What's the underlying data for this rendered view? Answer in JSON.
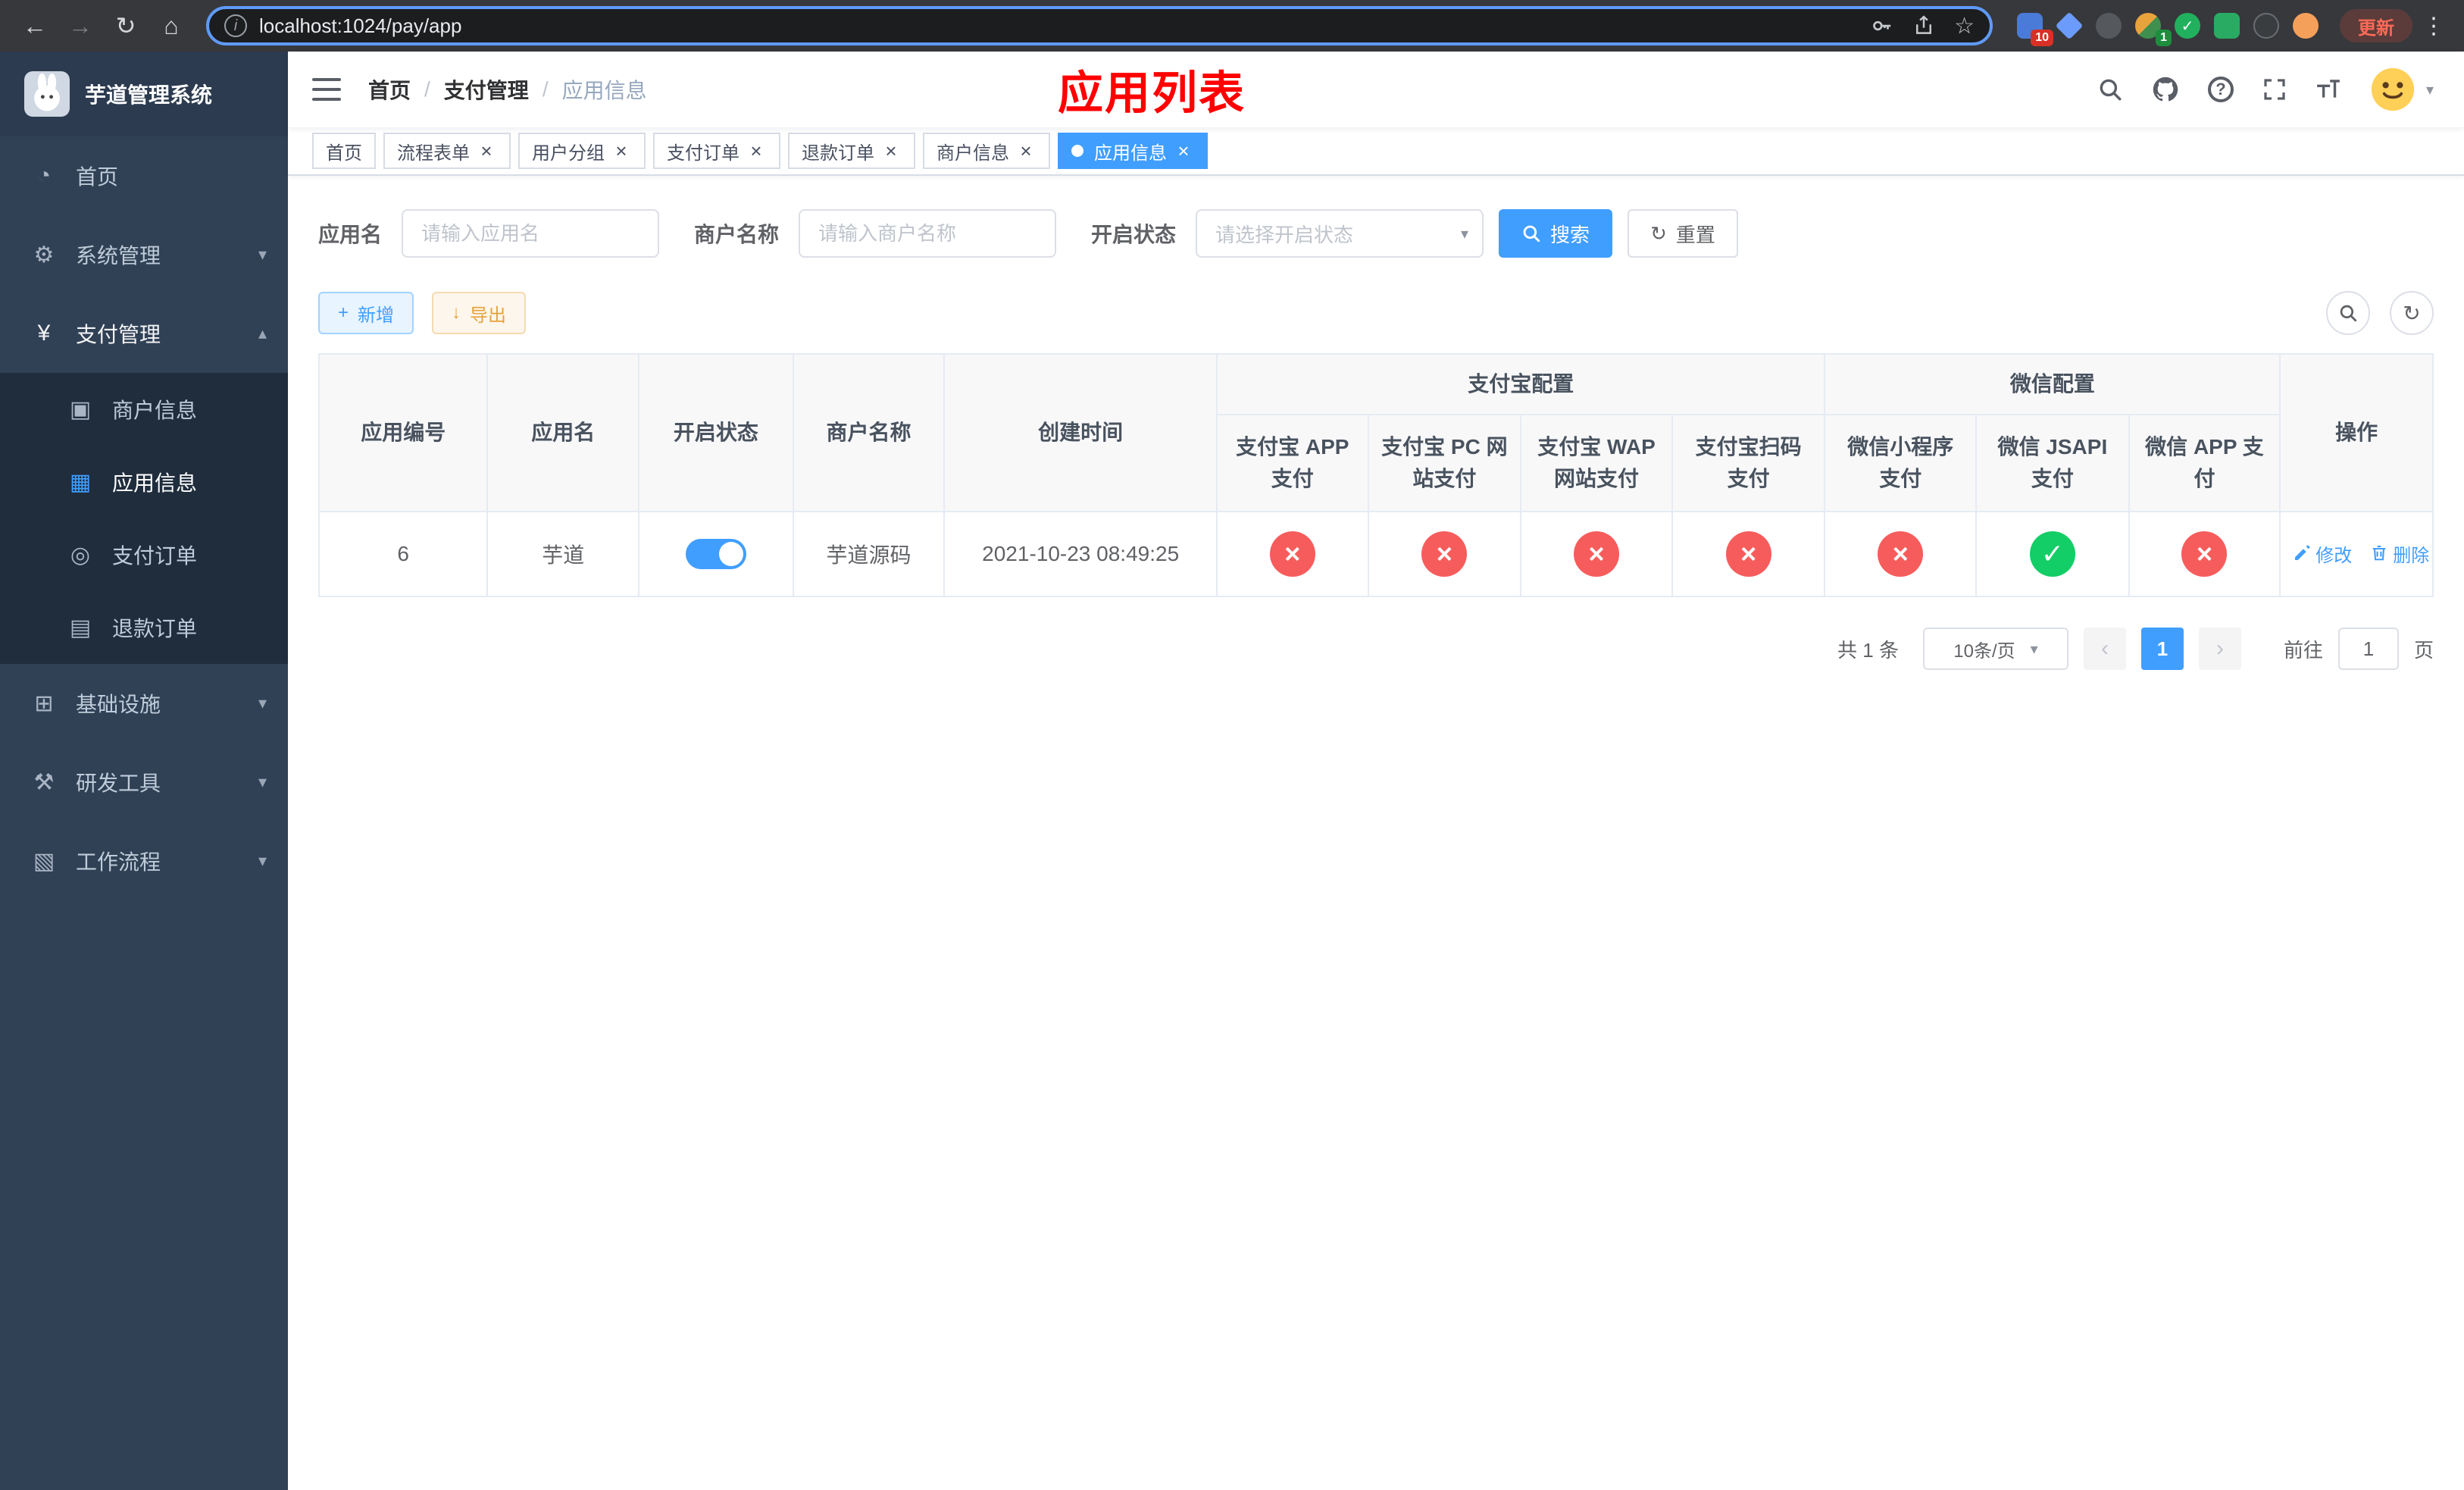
{
  "browser": {
    "url": "localhost:1024/pay/app",
    "update_button": "更新",
    "ext_badges": {
      "grid": "10",
      "profile": "1"
    }
  },
  "icons": {
    "back": "←",
    "forward": "→",
    "reload": "↻",
    "home": "⌂",
    "info": "i",
    "star": "☆",
    "menu_dots": "⋮",
    "caret_down": "▾",
    "caret_up": "▴",
    "close": "×",
    "check": "✓",
    "cross": "×",
    "plus": "+",
    "download": "↓",
    "refresh": "↻",
    "prev": "‹",
    "next": "›",
    "question": "?",
    "dashboard": "◔",
    "system": "⚙",
    "payment": "¥",
    "merchant": "▣",
    "app_info": "▦",
    "pay_order": "◎",
    "refund_order": "▤",
    "infra": "⊞",
    "devtools": "⚒",
    "workflow": "▧"
  },
  "sidebar": {
    "logo_title": "芋道管理系统",
    "items": [
      {
        "label": "首页"
      },
      {
        "label": "系统管理"
      },
      {
        "label": "支付管理"
      },
      {
        "label": "基础设施"
      },
      {
        "label": "研发工具"
      },
      {
        "label": "工作流程"
      }
    ],
    "payment_children": [
      {
        "label": "商户信息"
      },
      {
        "label": "应用信息",
        "active": true
      },
      {
        "label": "支付订单"
      },
      {
        "label": "退款订单"
      }
    ]
  },
  "header": {
    "breadcrumb": [
      "首页",
      "支付管理",
      "应用信息"
    ],
    "separator": "/",
    "page_title": "应用列表"
  },
  "tabs": [
    {
      "label": "首页",
      "closable": false
    },
    {
      "label": "流程表单",
      "closable": true
    },
    {
      "label": "用户分组",
      "closable": true
    },
    {
      "label": "支付订单",
      "closable": true
    },
    {
      "label": "退款订单",
      "closable": true
    },
    {
      "label": "商户信息",
      "closable": true
    },
    {
      "label": "应用信息",
      "closable": true,
      "active": true
    }
  ],
  "filters": {
    "app_name_label": "应用名",
    "app_name_placeholder": "请输入应用名",
    "merchant_label": "商户名称",
    "merchant_placeholder": "请输入商户名称",
    "status_label": "开启状态",
    "status_placeholder": "请选择开启状态",
    "search_button": "搜索",
    "reset_button": "重置"
  },
  "toolbar": {
    "add_button": "新增",
    "export_button": "导出"
  },
  "table": {
    "groups": {
      "alipay": "支付宝配置",
      "wechat": "微信配置"
    },
    "columns": {
      "id": "应用编号",
      "name": "应用名",
      "status": "开启状态",
      "merchant": "商户名称",
      "created": "创建时间",
      "alipay_app": "支付宝 APP 支付",
      "alipay_pc": "支付宝 PC 网站支付",
      "alipay_wap": "支付宝 WAP 网站支付",
      "alipay_qr": "支付宝扫码支付",
      "wx_mini": "微信小程序支付",
      "wx_jsapi": "微信 JSAPI 支付",
      "wx_app": "微信 APP 支付",
      "ops": "操作"
    },
    "rows": [
      {
        "id": "6",
        "name": "芋道",
        "enabled": true,
        "merchant": "芋道源码",
        "created": "2021-10-23 08:49:25",
        "alipay_app": false,
        "alipay_pc": false,
        "alipay_wap": false,
        "alipay_qr": false,
        "wx_mini": false,
        "wx_jsapi": true,
        "wx_app": false,
        "edit": "修改",
        "delete": "删除"
      }
    ]
  },
  "pagination": {
    "total": "共 1 条",
    "page_size": "10条/页",
    "current_page": "1",
    "goto_label": "前往",
    "goto_value": "1",
    "page_unit": "页"
  },
  "colors": {
    "accent": "#409EFF",
    "danger": "#F75C5C",
    "success": "#13CE66",
    "warning": "#E6A23C",
    "title_red": "#FF0000",
    "sidebar_bg": "#304156",
    "submenu_bg": "#1F2D3D"
  }
}
